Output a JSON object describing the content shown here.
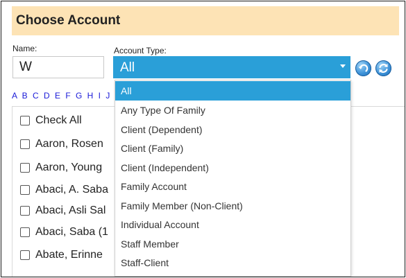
{
  "header": {
    "title": "Choose Account"
  },
  "form": {
    "name_label": "Name:",
    "name_value": "W",
    "type_label": "Account Type:",
    "type_value": "All"
  },
  "buttons": {
    "back_icon": "undo-arrow-icon",
    "refresh_icon": "refresh-icon"
  },
  "alphabet": "A B C D E F G H I J K",
  "alphabet_visible": "A B C D E F G H I J",
  "accounts": [
    "Check All",
    "Aaron, Rosen",
    "Aaron, Young",
    "Abaci, A. Saba",
    "Abaci, Asli Sal",
    "Abaci, Saba (1",
    "Abate, Erinne"
  ],
  "dropdown_options": [
    "All",
    "Any Type Of Family",
    "Client (Dependent)",
    "Client (Family)",
    "Client (Independent)",
    "Family Account",
    "Family Member (Non-Client)",
    "Individual Account",
    "Staff Member",
    "Staff-Client"
  ],
  "colors": {
    "header_bg": "#fde3b5",
    "accent": "#2a9fd8",
    "link": "#1a1ad8"
  }
}
